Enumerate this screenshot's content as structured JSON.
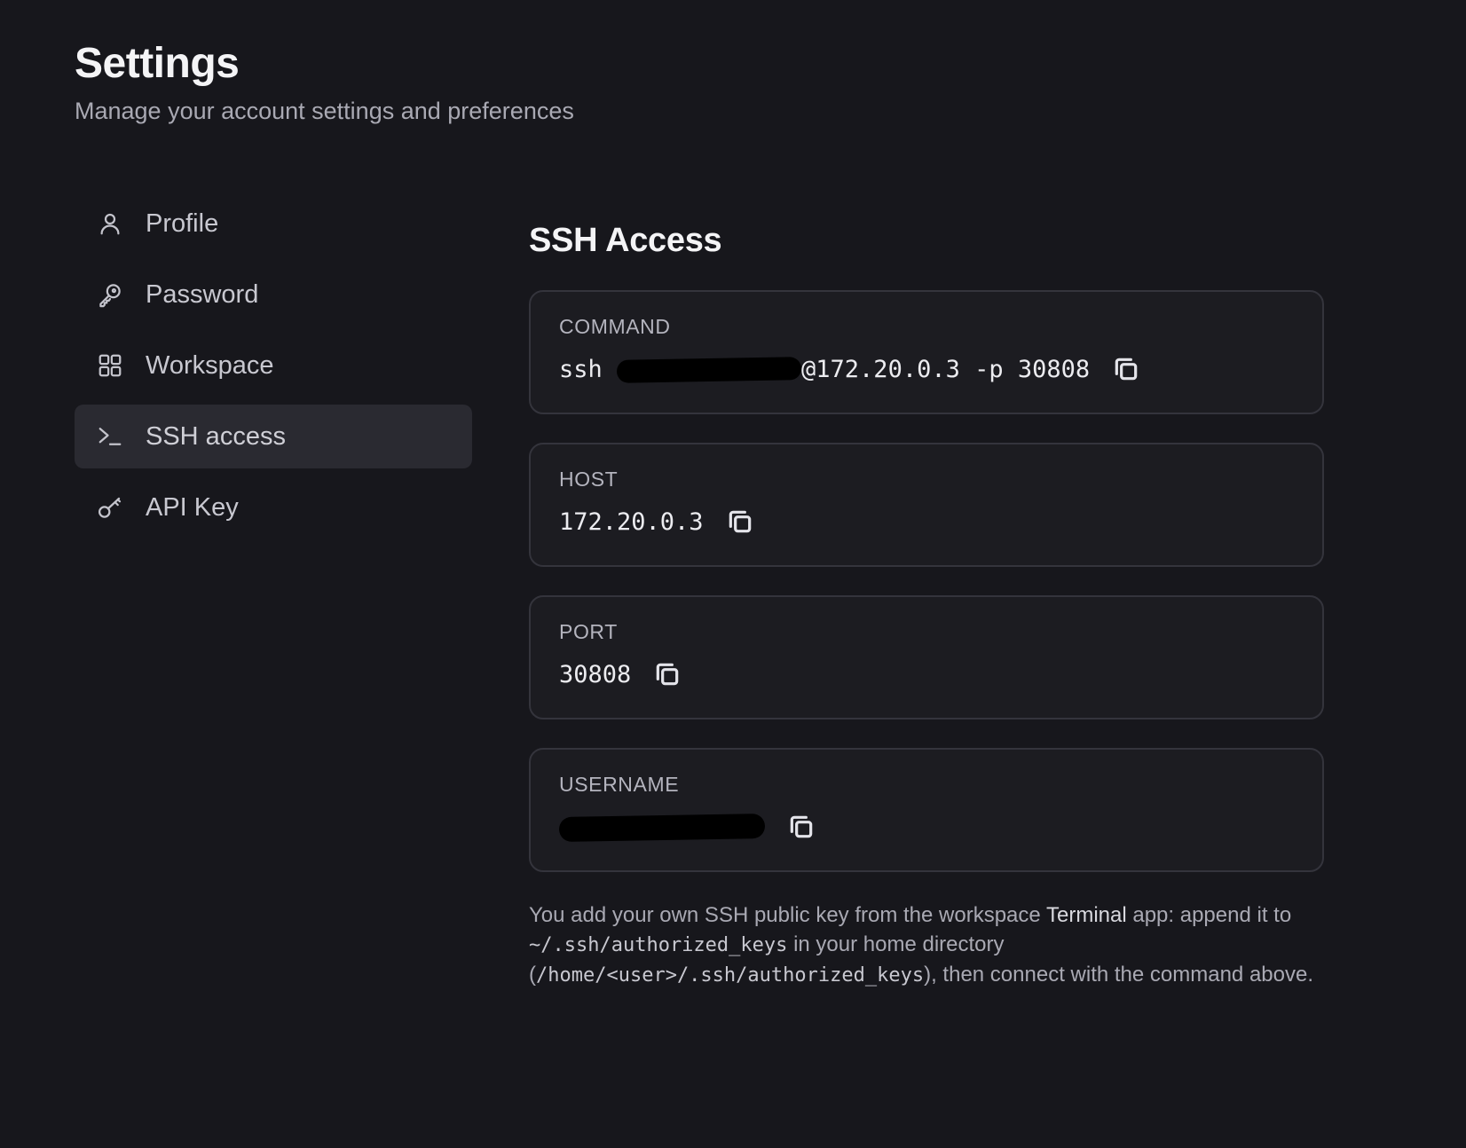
{
  "header": {
    "title": "Settings",
    "subtitle": "Manage your account settings and preferences"
  },
  "sidebar": {
    "items": [
      {
        "label": "Profile",
        "icon": "user-icon",
        "active": false
      },
      {
        "label": "Password",
        "icon": "key-icon",
        "active": false
      },
      {
        "label": "Workspace",
        "icon": "grid-icon",
        "active": false
      },
      {
        "label": "SSH access",
        "icon": "terminal-icon",
        "active": true
      },
      {
        "label": "API Key",
        "icon": "api-key-icon",
        "active": false
      }
    ]
  },
  "main": {
    "section_title": "SSH Access",
    "fields": {
      "command": {
        "label": "COMMAND",
        "prefix": "ssh ",
        "suffix": "@172.20.0.3 -p 30808"
      },
      "host": {
        "label": "HOST",
        "value": "172.20.0.3"
      },
      "port": {
        "label": "PORT",
        "value": "30808"
      },
      "username": {
        "label": "USERNAME"
      }
    },
    "help": {
      "part1": "You add your own SSH public key from the workspace ",
      "terminal": "Terminal",
      "part2": " app: append it to ",
      "path1": "~/.ssh/authorized_keys",
      "part3": " in your home directory (",
      "path2": "/home/<user>/.ssh/authorized_keys",
      "part4": "), then connect with the command above."
    }
  },
  "colors": {
    "background": "#17171c",
    "card": "#1c1c21",
    "active_nav": "#2a2a31"
  }
}
